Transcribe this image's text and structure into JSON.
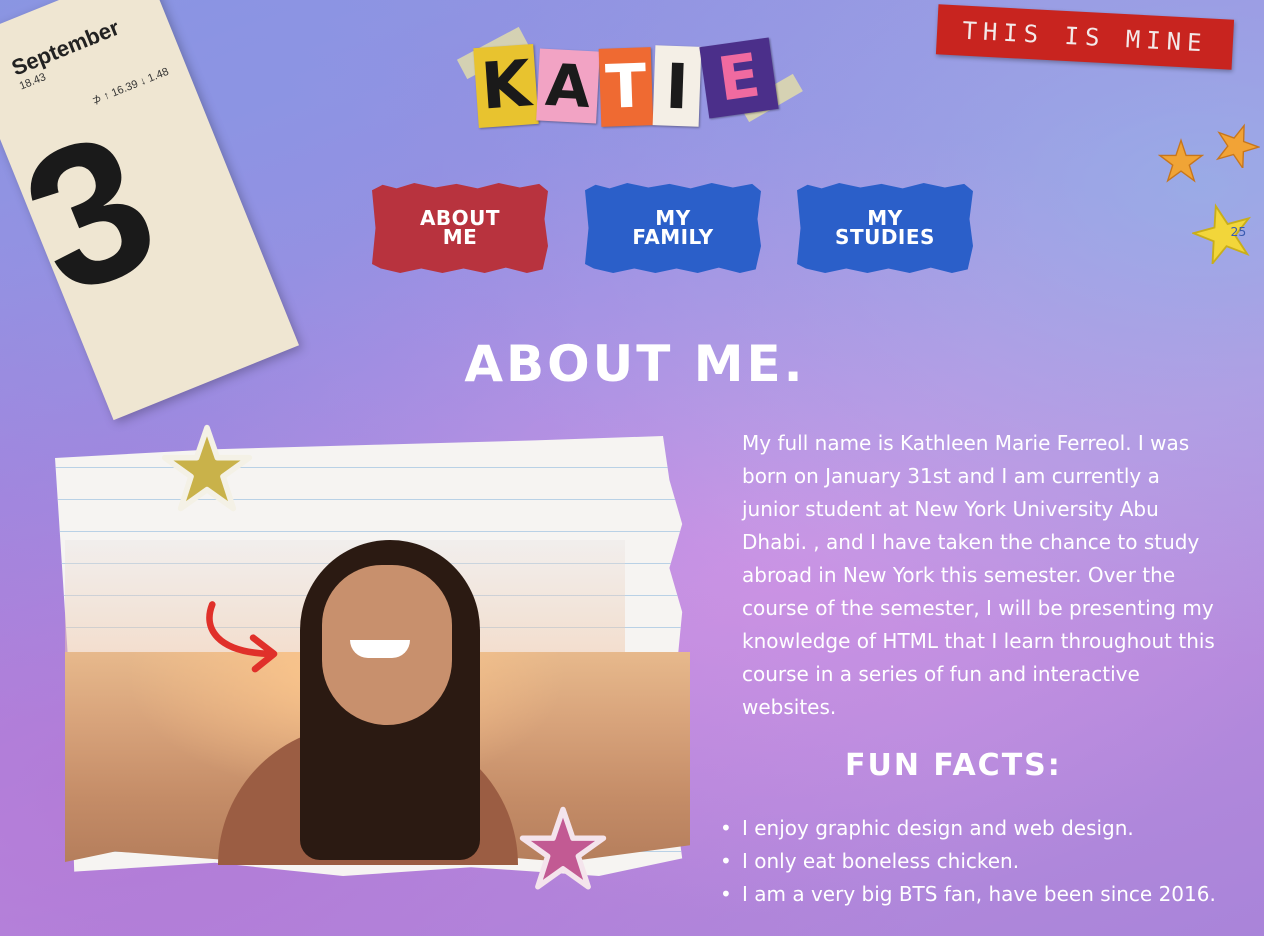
{
  "calendar": {
    "month": "September",
    "time": "18.43",
    "sun": "⊅ ↑ 16.39 ↓ 1.48",
    "day": "3"
  },
  "label": {
    "text": "THIS IS MINE"
  },
  "logo": {
    "letters": [
      "K",
      "A",
      "T",
      "I",
      "E"
    ]
  },
  "nav": [
    {
      "line1": "ABOUT",
      "line2": "ME",
      "color": "#b8333e"
    },
    {
      "line1": "MY",
      "line2": "FAMILY",
      "color": "#2b5fc9"
    },
    {
      "line1": "MY",
      "line2": "STUDIES",
      "color": "#2b5fc9"
    }
  ],
  "page": {
    "title": "ABOUT ME."
  },
  "bio": "My full name is Kathleen Marie Ferreol. I was born on January 31st and I am currently a junior student at New York University Abu Dhabi. , and I have taken the chance to study abroad in New York this semester. Over the course of the semester, I will be presenting my knowledge of HTML that I learn throughout this course in a series of fun and interactive websites.",
  "fun_facts": {
    "title": "FUN FACTS:",
    "items": [
      "I enjoy graphic design and web design.",
      "I only eat boneless chicken.",
      "I am a very big BTS fan, have been since 2016."
    ]
  },
  "stickers": {
    "yellow_star_number": "25"
  },
  "colors": {
    "label_red": "#c8241f",
    "nav_red": "#b8333e",
    "nav_blue": "#2b5fc9",
    "star_gold": "#f2c437"
  }
}
